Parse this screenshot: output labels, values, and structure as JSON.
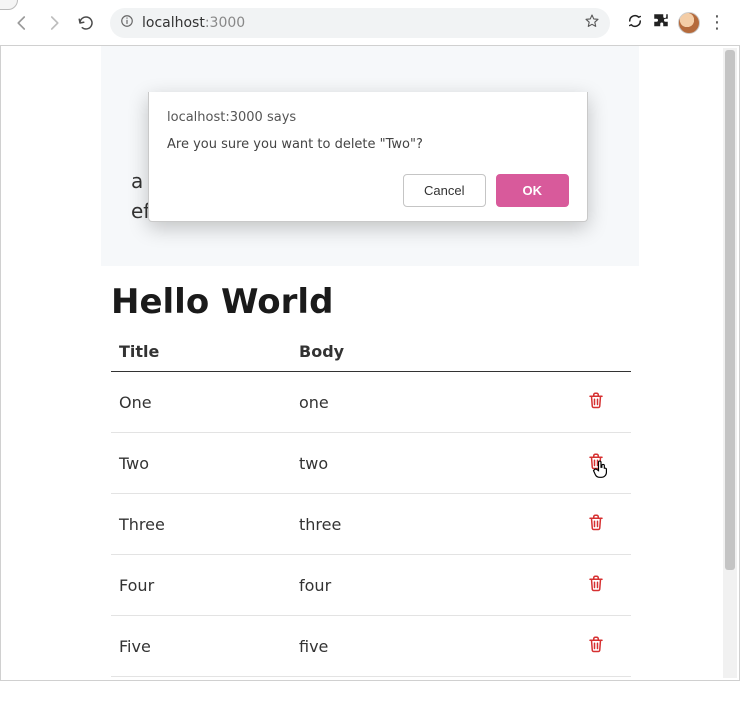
{
  "browser": {
    "url_host": "localhost",
    "url_rest": ":3000"
  },
  "dialog": {
    "origin_line": "localhost:3000 says",
    "message": "Are you sure you want to delete \"Two\"?",
    "cancel_label": "Cancel",
    "ok_label": "OK"
  },
  "header_box_text": "a table row with a delete button and fade effect.",
  "page_title": "Hello World",
  "table": {
    "columns": {
      "title": "Title",
      "body": "Body"
    },
    "rows": [
      {
        "title": "One",
        "body": "one"
      },
      {
        "title": "Two",
        "body": "two"
      },
      {
        "title": "Three",
        "body": "three"
      },
      {
        "title": "Four",
        "body": "four"
      },
      {
        "title": "Five",
        "body": "five"
      }
    ]
  }
}
